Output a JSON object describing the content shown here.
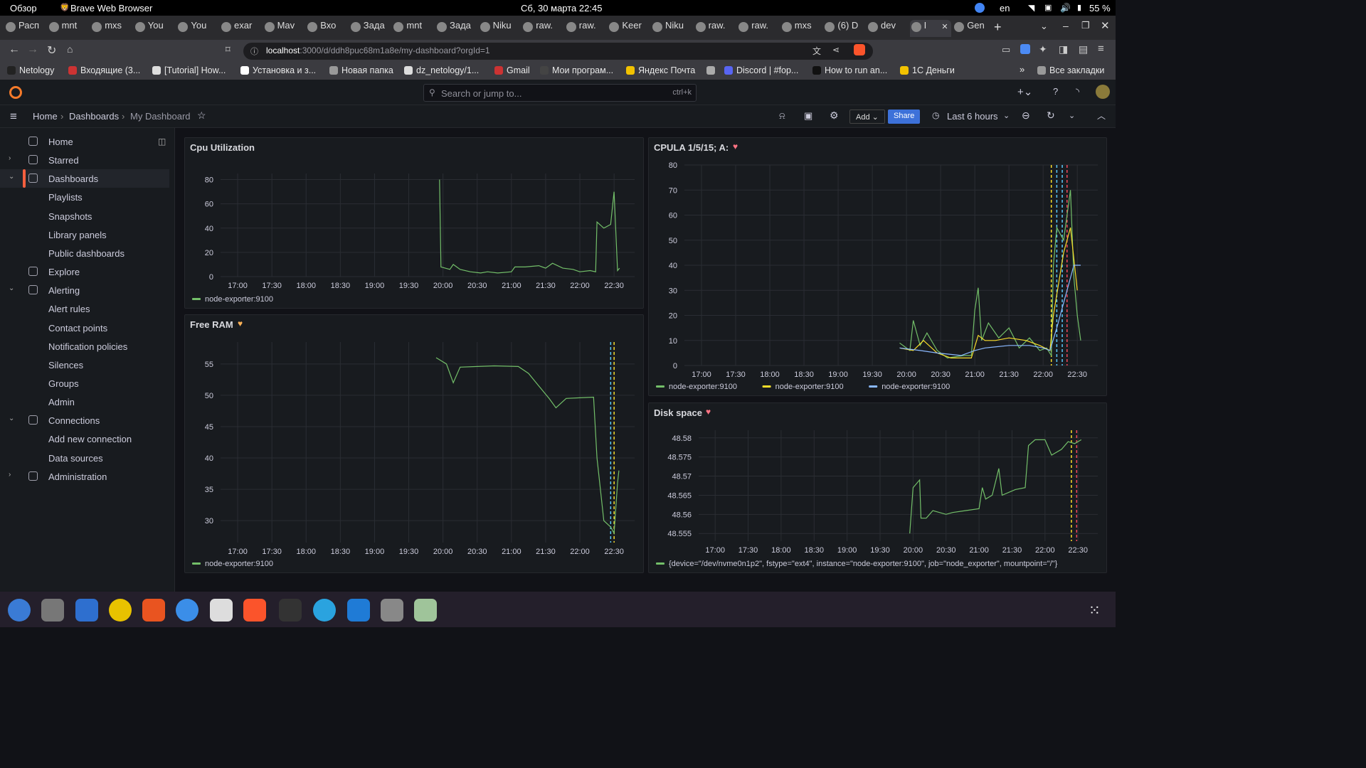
{
  "system": {
    "activities": "Обзор",
    "app": "Brave Web Browser",
    "datetime": "Сб, 30 марта  22:45",
    "lang": "en",
    "battery": "55 %"
  },
  "tabs": [
    "Расп",
    "mnt",
    "mxs",
    "You",
    "You",
    "exar",
    "Mav",
    "Вхо",
    "Зада",
    "mnt",
    "Зада",
    "Niku",
    "raw.",
    "raw.",
    "Keer",
    "Niku",
    "raw.",
    "raw.",
    "mxs",
    "(6) D",
    "dev",
    "I",
    "Gen"
  ],
  "active_tab_index": 21,
  "url": {
    "host": "localhost",
    "rest": ":3000/d/ddh8puc68m1a8e/my-dashboard?orgId=1"
  },
  "bookmarks": [
    {
      "label": "Netology",
      "color": "#222"
    },
    {
      "label": "Входящие (3...",
      "color": "#c33"
    },
    {
      "label": "[Tutorial] How...",
      "color": "#ddd"
    },
    {
      "label": "Установка и з...",
      "color": "#fff"
    },
    {
      "label": "Новая папка",
      "color": "#999"
    },
    {
      "label": "dz_netology/1...",
      "color": "#ddd"
    },
    {
      "label": "Gmail",
      "color": "#c33"
    },
    {
      "label": "Мои програм...",
      "color": "#444"
    },
    {
      "label": "Яндекс Почта",
      "color": "#f2c200"
    },
    {
      "label": "",
      "color": "#aaa"
    },
    {
      "label": "Discord | #fop...",
      "color": "#5865f2"
    },
    {
      "label": "How to run an...",
      "color": "#111"
    },
    {
      "label": "1С Деньги",
      "color": "#f2c200"
    }
  ],
  "all_bookmarks": "Все закладки",
  "search": {
    "placeholder": "Search or jump to...",
    "shortcut": "ctrl+k"
  },
  "breadcrumb": {
    "home": "Home",
    "dashboards": "Dashboards",
    "current": "My Dashboard"
  },
  "toolbar": {
    "add": "Add",
    "share": "Share",
    "time_range": "Last 6 hours"
  },
  "sidebar": [
    {
      "label": "Home",
      "icon": "home-icon",
      "level": 0
    },
    {
      "label": "Starred",
      "icon": "star-icon",
      "level": 0,
      "chev": "›"
    },
    {
      "label": "Dashboards",
      "icon": "apps-icon",
      "level": 0,
      "chev": "⌄",
      "active": true
    },
    {
      "label": "Playlists",
      "level": 1
    },
    {
      "label": "Snapshots",
      "level": 1
    },
    {
      "label": "Library panels",
      "level": 1
    },
    {
      "label": "Public dashboards",
      "level": 1
    },
    {
      "label": "Explore",
      "icon": "compass-icon",
      "level": 0
    },
    {
      "label": "Alerting",
      "icon": "bell-icon",
      "level": 0,
      "chev": "⌄"
    },
    {
      "label": "Alert rules",
      "level": 1
    },
    {
      "label": "Contact points",
      "level": 1
    },
    {
      "label": "Notification policies",
      "level": 1
    },
    {
      "label": "Silences",
      "level": 1
    },
    {
      "label": "Groups",
      "level": 1
    },
    {
      "label": "Admin",
      "level": 1
    },
    {
      "label": "Connections",
      "icon": "plug-icon",
      "level": 0,
      "chev": "⌄"
    },
    {
      "label": "Add new connection",
      "level": 1
    },
    {
      "label": "Data sources",
      "level": 1
    },
    {
      "label": "Administration",
      "icon": "cog-icon",
      "level": 0,
      "chev": "›"
    }
  ],
  "colors": {
    "green": "#73bf69",
    "yellow": "#fade2a",
    "blue": "#8ab8ff",
    "cyan": "#5ac8fa",
    "red": "#f2495c",
    "pink": "#ff7383",
    "orange": "#ffb357",
    "accent": "#3d71d9"
  },
  "panels": [
    {
      "id": "cpu",
      "title": "Cpu Utilization",
      "heart": "",
      "chart_data": {
        "type": "line",
        "x_ticks": [
          "17:00",
          "17:30",
          "18:00",
          "18:30",
          "19:00",
          "19:30",
          "20:00",
          "20:30",
          "21:00",
          "21:30",
          "22:00",
          "22:30"
        ],
        "ylim": [
          0,
          85
        ],
        "y_ticks": [
          0,
          20,
          40,
          60,
          80
        ],
        "series": [
          {
            "name": "node-exporter:9100",
            "color": "#73bf69",
            "points": [
              [
                19.95,
                80
              ],
              [
                19.97,
                8
              ],
              [
                20.1,
                6
              ],
              [
                20.15,
                10
              ],
              [
                20.25,
                6
              ],
              [
                20.4,
                4
              ],
              [
                20.55,
                3
              ],
              [
                20.65,
                4
              ],
              [
                20.8,
                3
              ],
              [
                21.0,
                4
              ],
              [
                21.05,
                8
              ],
              [
                21.2,
                8
              ],
              [
                21.4,
                9
              ],
              [
                21.5,
                7
              ],
              [
                21.6,
                11
              ],
              [
                21.75,
                7
              ],
              [
                21.9,
                6
              ],
              [
                22.0,
                4
              ],
              [
                22.15,
                5
              ],
              [
                22.23,
                4
              ],
              [
                22.25,
                45
              ],
              [
                22.35,
                40
              ],
              [
                22.45,
                43
              ],
              [
                22.5,
                70
              ],
              [
                22.55,
                5
              ],
              [
                22.58,
                7
              ]
            ]
          }
        ]
      }
    },
    {
      "id": "ram",
      "title": "Free RAM",
      "heart": "orange",
      "chart_data": {
        "type": "line",
        "x_ticks": [
          "17:00",
          "17:30",
          "18:00",
          "18:30",
          "19:00",
          "19:30",
          "20:00",
          "20:30",
          "21:00",
          "21:30",
          "22:00",
          "22:30"
        ],
        "ylim": [
          26.5,
          58.5
        ],
        "y_ticks": [
          30,
          35,
          40,
          45,
          50,
          55
        ],
        "series": [
          {
            "name": "node-exporter:9100",
            "color": "#73bf69",
            "points": [
              [
                19.9,
                56
              ],
              [
                20.05,
                55
              ],
              [
                20.15,
                52
              ],
              [
                20.25,
                54.5
              ],
              [
                20.5,
                54.6
              ],
              [
                20.75,
                54.7
              ],
              [
                21.1,
                54.6
              ],
              [
                21.25,
                53.5
              ],
              [
                21.4,
                51.5
              ],
              [
                21.55,
                49.5
              ],
              [
                21.65,
                48
              ],
              [
                21.8,
                49.5
              ],
              [
                22.0,
                49.6
              ],
              [
                22.2,
                49.7
              ],
              [
                22.25,
                40
              ],
              [
                22.35,
                30
              ],
              [
                22.45,
                29
              ],
              [
                22.5,
                28
              ],
              [
                22.55,
                36
              ],
              [
                22.57,
                38
              ]
            ]
          }
        ],
        "threshold_lines": [
          {
            "x": 22.45,
            "color": "#5ac8fa"
          },
          {
            "x": 22.5,
            "color": "#fade2a"
          }
        ]
      }
    },
    {
      "id": "cpula",
      "title": "CPULA 1/5/15; A:",
      "heart": "pink",
      "chart_data": {
        "type": "line",
        "x_ticks": [
          "17:00",
          "17:30",
          "18:00",
          "18:30",
          "19:00",
          "19:30",
          "20:00",
          "20:30",
          "21:00",
          "21:30",
          "22:00",
          "22:30"
        ],
        "ylim": [
          0,
          80
        ],
        "y_ticks": [
          0,
          10,
          20,
          30,
          40,
          50,
          60,
          70,
          80
        ],
        "series": [
          {
            "name": "node-exporter:9100",
            "color": "#73bf69",
            "points": [
              [
                19.9,
                9
              ],
              [
                20.05,
                6
              ],
              [
                20.1,
                18
              ],
              [
                20.2,
                8
              ],
              [
                20.3,
                13
              ],
              [
                20.45,
                6
              ],
              [
                20.6,
                3
              ],
              [
                20.85,
                4
              ],
              [
                20.95,
                4
              ],
              [
                21.0,
                22
              ],
              [
                21.05,
                31
              ],
              [
                21.1,
                10
              ],
              [
                21.2,
                17
              ],
              [
                21.35,
                11
              ],
              [
                21.5,
                15
              ],
              [
                21.65,
                7
              ],
              [
                21.8,
                11
              ],
              [
                21.95,
                6
              ],
              [
                22.05,
                7
              ],
              [
                22.12,
                4
              ],
              [
                22.15,
                40
              ],
              [
                22.2,
                55
              ],
              [
                22.3,
                50
              ],
              [
                22.4,
                70
              ],
              [
                22.45,
                35
              ],
              [
                22.5,
                20
              ],
              [
                22.55,
                10
              ]
            ]
          },
          {
            "name": "node-exporter:9100",
            "color": "#fade2a",
            "points": [
              [
                19.9,
                7
              ],
              [
                20.1,
                6
              ],
              [
                20.25,
                10
              ],
              [
                20.45,
                5
              ],
              [
                20.65,
                3
              ],
              [
                20.95,
                3
              ],
              [
                21.05,
                12
              ],
              [
                21.15,
                10
              ],
              [
                21.3,
                10
              ],
              [
                21.5,
                11
              ],
              [
                21.75,
                10
              ],
              [
                21.95,
                8
              ],
              [
                22.1,
                6
              ],
              [
                22.15,
                20
              ],
              [
                22.3,
                45
              ],
              [
                22.4,
                55
              ],
              [
                22.5,
                30
              ]
            ]
          },
          {
            "name": "node-exporter:9100",
            "color": "#8ab8ff",
            "points": [
              [
                19.9,
                7
              ],
              [
                20.2,
                6
              ],
              [
                20.45,
                5
              ],
              [
                20.8,
                4
              ],
              [
                21.0,
                6
              ],
              [
                21.15,
                7
              ],
              [
                21.5,
                8
              ],
              [
                21.8,
                8
              ],
              [
                22.0,
                7
              ],
              [
                22.1,
                6
              ],
              [
                22.2,
                15
              ],
              [
                22.35,
                30
              ],
              [
                22.45,
                40
              ],
              [
                22.55,
                40
              ]
            ]
          }
        ],
        "threshold_lines": [
          {
            "x": 22.12,
            "color": "#fade2a"
          },
          {
            "x": 22.2,
            "color": "#5ac8fa"
          },
          {
            "x": 22.28,
            "color": "#5ac8fa"
          },
          {
            "x": 22.35,
            "color": "#f2495c"
          }
        ]
      }
    },
    {
      "id": "disk",
      "title": "Disk space",
      "heart": "pink",
      "chart_data": {
        "type": "line",
        "x_ticks": [
          "17:00",
          "17:30",
          "18:00",
          "18:30",
          "19:00",
          "19:30",
          "20:00",
          "20:30",
          "21:00",
          "21:30",
          "22:00",
          "22:30"
        ],
        "ylim": [
          48.553,
          48.582
        ],
        "y_ticks": [
          48.555,
          48.56,
          48.565,
          48.57,
          48.575,
          48.58
        ],
        "series": [
          {
            "name": "{device=\"/dev/nvme0n1p2\", fstype=\"ext4\", instance=\"node-exporter:9100\", job=\"node_exporter\", mountpoint=\"/\"}",
            "color": "#73bf69",
            "points": [
              [
                19.95,
                48.555
              ],
              [
                20.0,
                48.567
              ],
              [
                20.1,
                48.569
              ],
              [
                20.12,
                48.559
              ],
              [
                20.2,
                48.559
              ],
              [
                20.3,
                48.561
              ],
              [
                20.5,
                48.56
              ],
              [
                20.6,
                48.5605
              ],
              [
                20.8,
                48.561
              ],
              [
                21.0,
                48.5615
              ],
              [
                21.05,
                48.567
              ],
              [
                21.1,
                48.564
              ],
              [
                21.2,
                48.565
              ],
              [
                21.3,
                48.572
              ],
              [
                21.35,
                48.565
              ],
              [
                21.55,
                48.5665
              ],
              [
                21.7,
                48.567
              ],
              [
                21.75,
                48.578
              ],
              [
                21.85,
                48.5795
              ],
              [
                22.0,
                48.5795
              ],
              [
                22.1,
                48.5755
              ],
              [
                22.25,
                48.577
              ],
              [
                22.35,
                48.579
              ],
              [
                22.45,
                48.5785
              ],
              [
                22.55,
                48.5795
              ]
            ]
          }
        ],
        "threshold_lines": [
          {
            "x": 22.4,
            "color": "#fade2a"
          },
          {
            "x": 22.48,
            "color": "#f2495c"
          }
        ]
      }
    }
  ]
}
